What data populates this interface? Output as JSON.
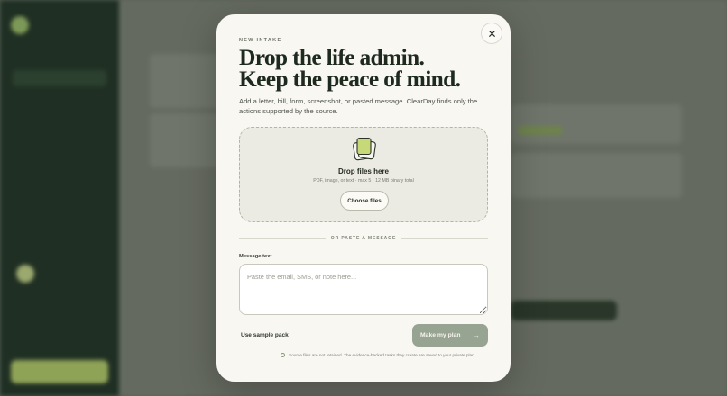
{
  "modal": {
    "eyebrow": "NEW INTAKE",
    "headline_line1": "Drop the life admin.",
    "headline_line2": "Keep the peace of mind.",
    "intro": "Add a letter, bill, form, screenshot, or pasted message. ClearDay finds only the actions supported by the source.",
    "close_icon": "close-icon",
    "dropzone": {
      "icon": "files-stack-icon",
      "title": "Drop files here",
      "hint": "PDF, image, or text · max 5 · 12 MB binary total",
      "choose_label": "Choose files"
    },
    "divider_label": "OR PASTE A MESSAGE",
    "message": {
      "label": "Message text",
      "placeholder": "Paste the email, SMS, or note here...",
      "value": ""
    },
    "sample_link": "Use sample pack",
    "primary_button": "Make my plan",
    "primary_icon": "arrow-right-icon",
    "footnote": "Source files are not retained. The evidence-backed tasks they create are saved to your private plan."
  },
  "colors": {
    "accent_dark": "#1f2a1f",
    "sidebar": "#1d3022",
    "lime": "#c8d88a",
    "primary_button": "#97a491",
    "modal_bg": "#f8f7f2"
  }
}
